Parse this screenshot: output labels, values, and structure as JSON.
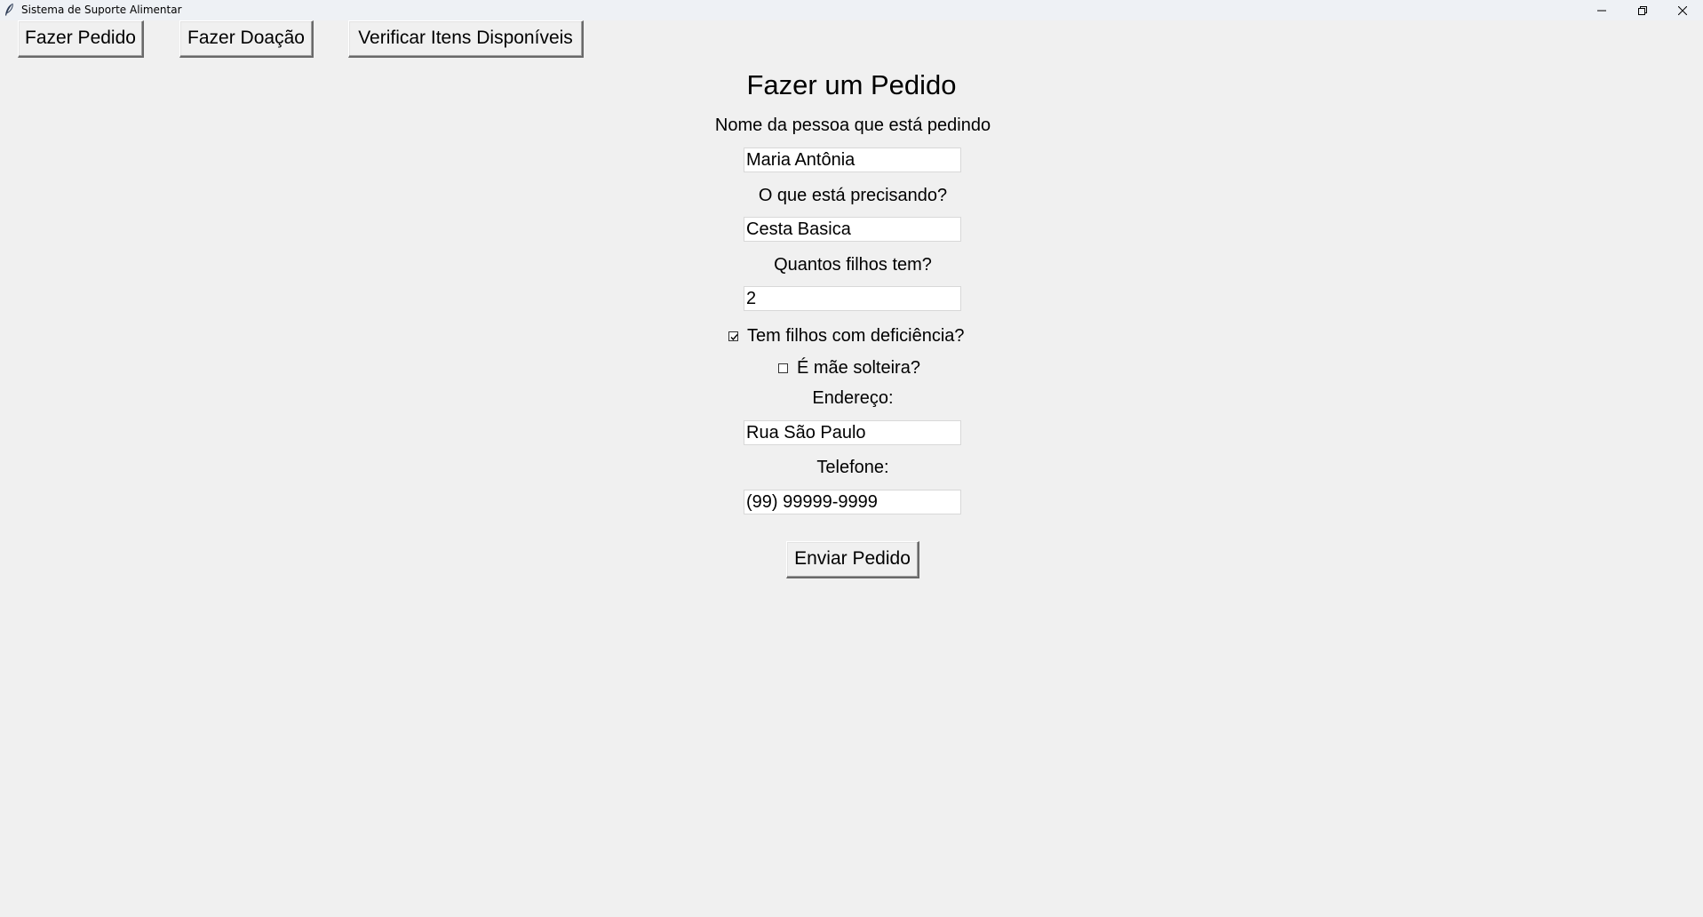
{
  "window": {
    "title": "Sistema de Suporte Alimentar",
    "icon": "feather-icon",
    "controls": [
      "minimize-icon",
      "restore-icon",
      "close-icon"
    ]
  },
  "nav": {
    "pedido_label": "Fazer Pedido",
    "doacao_label": "Fazer Doação",
    "verificar_label": "Verificar Itens Disponíveis"
  },
  "form": {
    "title": "Fazer um Pedido",
    "nome_label": "Nome da pessoa que está pedindo",
    "nome_value": "Maria Antônia",
    "necessidade_label": "O que está precisando?",
    "necessidade_value": "Cesta Basica",
    "filhos_label": "Quantos filhos tem?",
    "filhos_value": "2",
    "deficiencia_label": "Tem filhos com deficiência?",
    "deficiencia_checked": true,
    "mae_solteira_label": "É mãe solteira?",
    "mae_solteira_checked": false,
    "endereco_label": "Endereço:",
    "endereco_value": "Rua São Paulo",
    "telefone_label": "Telefone:",
    "telefone_value": "(99) 99999-9999",
    "submit_label": "Enviar Pedido"
  }
}
